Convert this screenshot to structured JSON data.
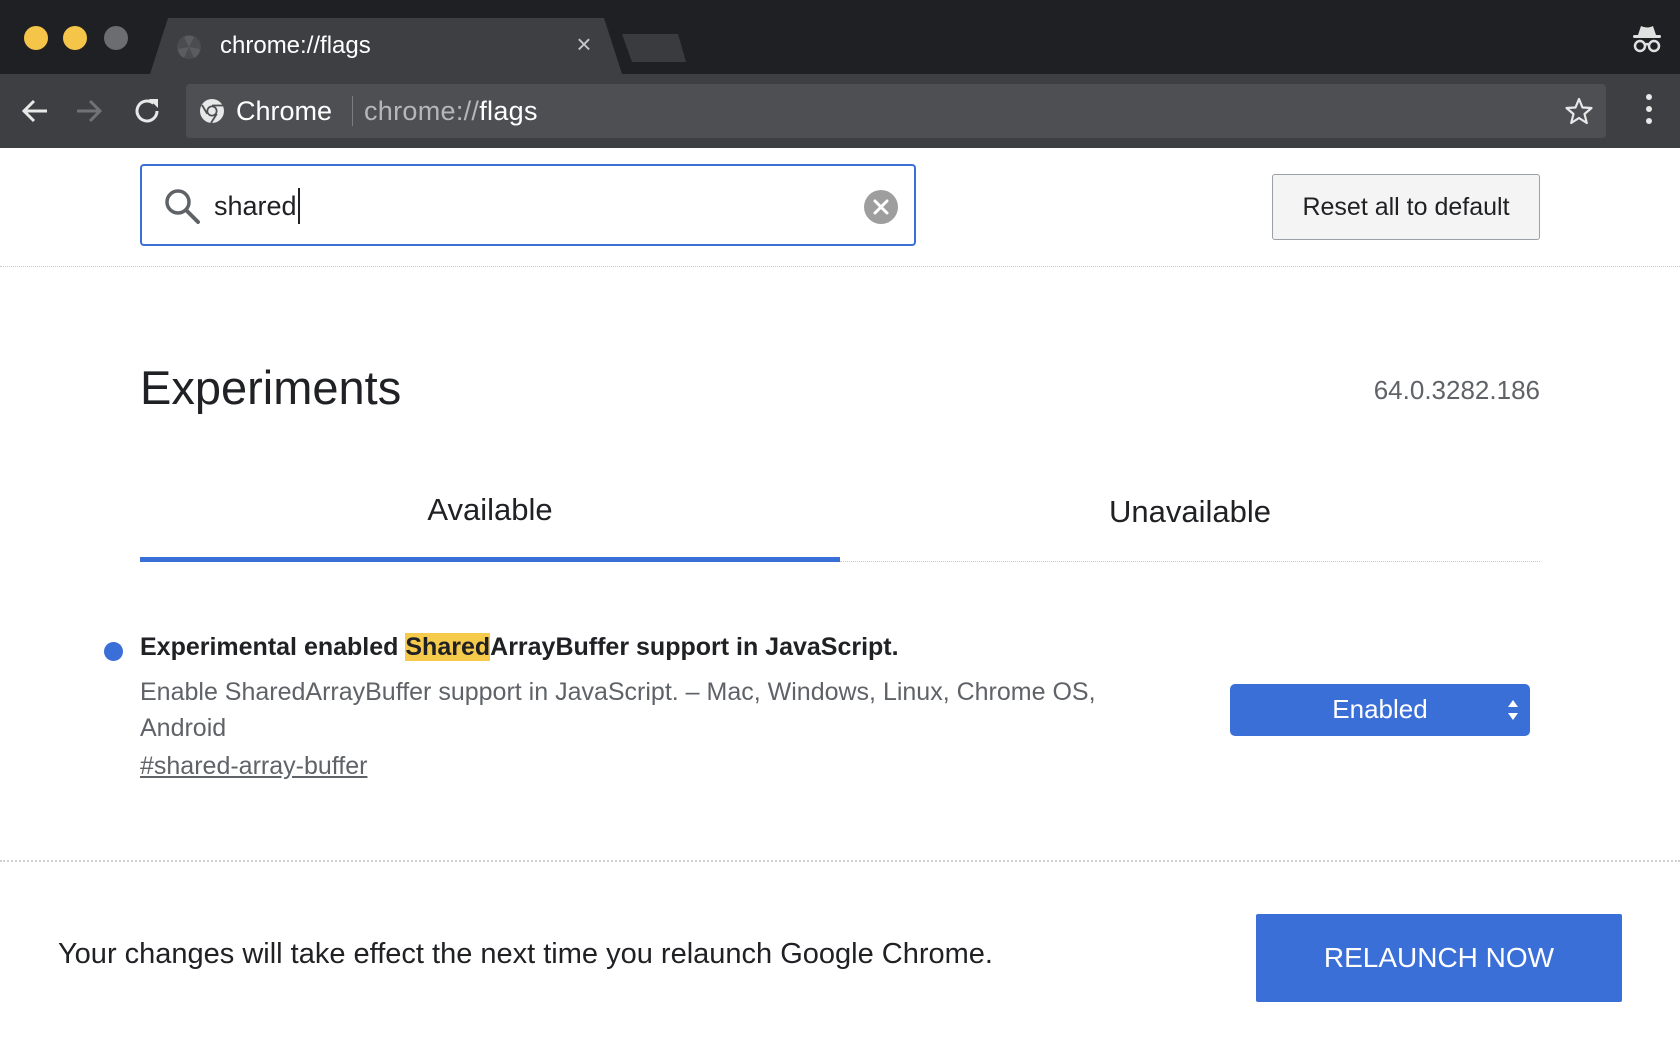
{
  "browser": {
    "tab": {
      "title": "chrome://flags",
      "close_glyph": "×",
      "favicon": "flags-icon"
    },
    "omnibox": {
      "site_label": "Chrome",
      "url_prefix": "chrome://",
      "url_path": "flags"
    }
  },
  "search": {
    "value": "shared",
    "clear_icon": "clear-icon"
  },
  "reset_button": "Reset all to default",
  "page": {
    "title": "Experiments",
    "version": "64.0.3282.186",
    "tabs": [
      {
        "label": "Available",
        "selected": true
      },
      {
        "label": "Unavailable",
        "selected": false
      }
    ]
  },
  "experiment": {
    "title_before": "Experimental enabled ",
    "title_highlight": "Shared",
    "title_after": "ArrayBuffer support in JavaScript.",
    "description": "Enable SharedArrayBuffer support in JavaScript. – Mac, Windows, Linux, Chrome OS, Android",
    "link": "#shared-array-buffer",
    "state": "Enabled"
  },
  "footer": {
    "message": "Your changes will take effect the next time you relaunch Google Chrome.",
    "relaunch": "RELAUNCH NOW"
  },
  "colors": {
    "accent": "#3b6fd8",
    "highlight": "#f6ca4b",
    "titlebar": "#1f2023",
    "toolbar": "#3d3f42"
  }
}
